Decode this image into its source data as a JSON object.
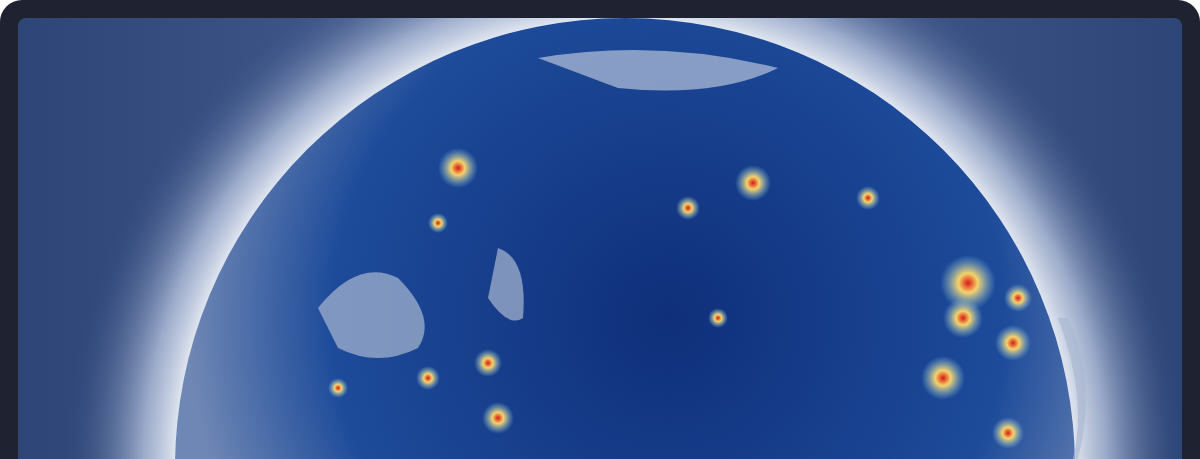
{
  "map": {
    "kind": "globe"
  }
}
